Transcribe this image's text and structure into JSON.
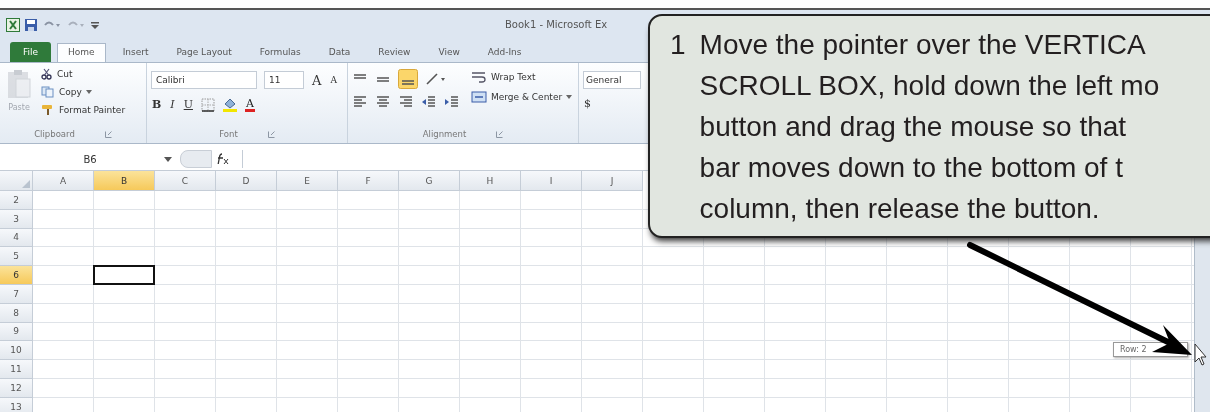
{
  "window": {
    "title": "Book1 - Microsoft Ex"
  },
  "tabs": [
    {
      "label": "File",
      "kind": "file",
      "selected": false
    },
    {
      "label": "Home",
      "kind": "tab",
      "selected": true
    },
    {
      "label": "Insert",
      "kind": "tab",
      "selected": false
    },
    {
      "label": "Page Layout",
      "kind": "tab",
      "selected": false
    },
    {
      "label": "Formulas",
      "kind": "tab",
      "selected": false
    },
    {
      "label": "Data",
      "kind": "tab",
      "selected": false
    },
    {
      "label": "Review",
      "kind": "tab",
      "selected": false
    },
    {
      "label": "View",
      "kind": "tab",
      "selected": false
    },
    {
      "label": "Add-Ins",
      "kind": "tab",
      "selected": false
    }
  ],
  "clipboard": {
    "paste": {
      "label": "Paste",
      "disabled": true
    },
    "cut": "Cut",
    "copy": "Copy",
    "format_painter": "Format Painter",
    "group_label": "Clipboard"
  },
  "font": {
    "font_name": "Calibri",
    "font_size": "11",
    "grow": "A",
    "shrink": "A",
    "style_buttons": [
      "B",
      "I",
      "U"
    ],
    "font_color": "A",
    "group_label": "Font"
  },
  "alignment": {
    "wrap_text": "Wrap Text",
    "merge_center": "Merge & Center",
    "group_label": "Alignment"
  },
  "number": {
    "format": "General",
    "currency": "$"
  },
  "formula_bar": {
    "name_box": "B6"
  },
  "sheet": {
    "columns": [
      {
        "label": "A",
        "selected": false
      },
      {
        "label": "B",
        "selected": true
      },
      {
        "label": "C",
        "selected": false
      },
      {
        "label": "D",
        "selected": false
      },
      {
        "label": "E",
        "selected": false
      },
      {
        "label": "F",
        "selected": false
      },
      {
        "label": "G",
        "selected": false
      },
      {
        "label": "H",
        "selected": false
      },
      {
        "label": "I",
        "selected": false
      },
      {
        "label": "J",
        "selected": false
      }
    ],
    "rows": [
      {
        "label": "2",
        "selected": false
      },
      {
        "label": "3",
        "selected": false
      },
      {
        "label": "4",
        "selected": false
      },
      {
        "label": "5",
        "selected": false
      },
      {
        "label": "6",
        "selected": true
      },
      {
        "label": "7",
        "selected": false
      },
      {
        "label": "8",
        "selected": false
      },
      {
        "label": "9",
        "selected": false
      },
      {
        "label": "10",
        "selected": false
      },
      {
        "label": "11",
        "selected": false
      },
      {
        "label": "12",
        "selected": false
      },
      {
        "label": "13",
        "selected": false
      }
    ]
  },
  "tooltip": "Row: 2",
  "callout": {
    "number": "1",
    "lines": [
      "Move the pointer over the VERTICA",
      "SCROLL BOX, hold down the left mo",
      "button and drag the mouse so that",
      "bar moves down to the bottom of t",
      "column, then release the button."
    ]
  }
}
